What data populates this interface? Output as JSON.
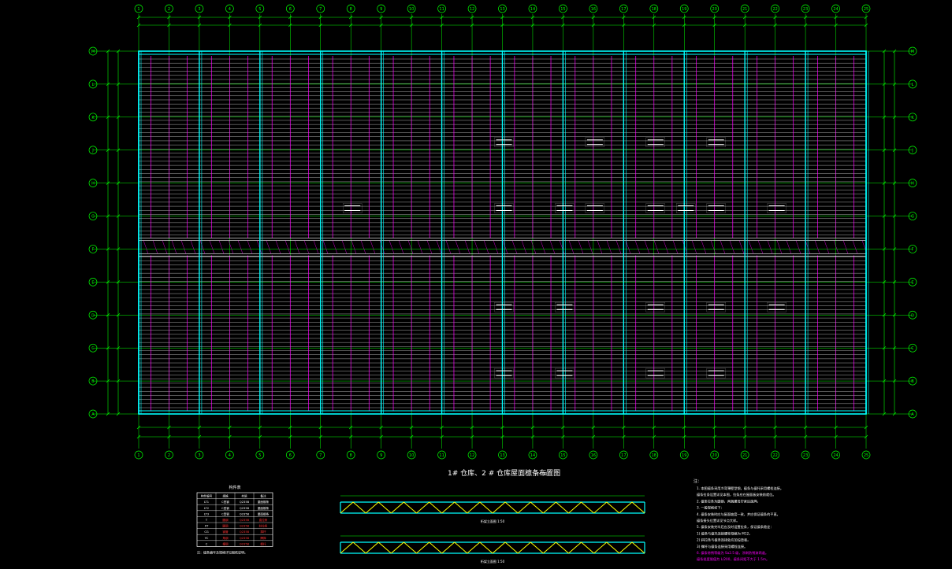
{
  "drawing": {
    "title": "1# 仓库、2 # 仓库屋面檩条布置图",
    "scale": "1:100",
    "colors": {
      "background": "#000000",
      "grid_axis": "#00ff00",
      "dimension": "#00ff00",
      "column_line": "#00ffff",
      "purlin": "#ffffff",
      "tie_rod": "#ff00ff",
      "truss_chord": "#00ffff",
      "truss_web": "#ffff00",
      "note_highlight": "#ff00ff"
    }
  },
  "axes": {
    "columns": [
      "1",
      "2",
      "3",
      "4",
      "5",
      "6",
      "7",
      "8",
      "9",
      "10",
      "11",
      "12",
      "13",
      "14",
      "15",
      "16",
      "17",
      "18",
      "19",
      "20",
      "21",
      "22",
      "23",
      "24",
      "25"
    ],
    "rows": [
      "M",
      "L",
      "K",
      "J",
      "H",
      "G",
      "F",
      "E",
      "D",
      "C",
      "B",
      "A"
    ]
  },
  "members_table": {
    "title": "构件表",
    "headers": [
      "构件编号",
      "规格",
      "材质",
      "备注"
    ],
    "rows": [
      [
        "LT1",
        "C型钢",
        "Q235B",
        "屋面檩条"
      ],
      [
        "LT2",
        "C型钢",
        "Q235B",
        "屋面檩条"
      ],
      [
        "LT3",
        "C型钢",
        "Q235B",
        "屋面檩条"
      ],
      [
        "T",
        "圆钢",
        "Q235B",
        "直拉条"
      ],
      [
        "XT",
        "圆钢",
        "Q235B",
        "斜拉条"
      ],
      [
        "CG",
        "钢管",
        "Q235B",
        "撑杆"
      ],
      [
        "YC",
        "角钢",
        "Q235B",
        "隅撑"
      ],
      [
        "C",
        "槽钢",
        "Q235B",
        "檩托"
      ]
    ],
    "footnote": "注：檩条编号及规格详见图纸说明。"
  },
  "trusses": {
    "top_label": "桁架立面图 1:50",
    "bottom_label": "桁架立面图 1:50"
  },
  "notes": {
    "heading": "注：",
    "items": [
      "1. 本图檩条采用冷弯薄壁型钢，檩条与檩托采用螺栓连接。",
      "   檩条拉条设置详见本图，拉条应在屋面板安装前就位。",
      "2. 檩条拉条为圆钢，两端螺母拧紧后施焊。",
      "3. 一般规格如下：",
      "4. 檩条安装时应与屋面坡度一致，并应保证檩条的平直。",
      "   檩条接头位置详见节点大样。",
      "5. 檩条安装完毕后应及时设置拉条，保证檩条稳定：",
      "   1) 檩条与檩托连接螺栓规格为 M12。",
      "   2) 斜拉条与檩条连接处应加设垫板。",
      "   3) 撑杆与檩条连接采用螺栓连接。",
      "6. 檩条除锈等级为 Sa2.5 级，涂刷防锈漆两道。",
      "   檩条挠度限值为 L/200，檩条间距不大于 1.5m。"
    ]
  }
}
